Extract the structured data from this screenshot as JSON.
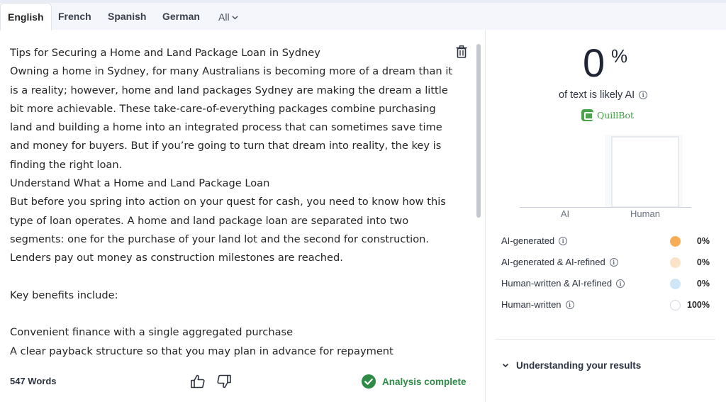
{
  "tabs": {
    "items": [
      {
        "label": "English",
        "active": true
      },
      {
        "label": "French",
        "active": false
      },
      {
        "label": "Spanish",
        "active": false
      },
      {
        "label": "German",
        "active": false
      }
    ],
    "all_label": "All"
  },
  "editor": {
    "paragraphs": [
      "Tips for Securing a Home and Land Package Loan in Sydney",
      "Owning a home in Sydney, for many Australians is becoming more of a dream than it is a reality; however, home and land packages Sydney are making the dream a little bit more achievable. These take-care-of-everything packages combine purchasing land and building a home into an integrated process that can sometimes save time and money for buyers. But if you’re going to turn that dream into reality, the key is finding the right loan.",
      "Understand What a Home and Land Package Loan",
      "But before you spring into action on your quest for cash, you need to know how this type of loan operates. A home and land package loan are separated into two segments: one for the purchase of your land lot and the second for construction. Lenders pay out money as construction milestones are reached.",
      "",
      "Key benefits include:",
      "",
      "Convenient finance with a single aggregated purchase",
      "A clear payback structure so that you may plan in advance for repayment"
    ],
    "word_count": "547 Words",
    "status": "Analysis complete"
  },
  "results": {
    "score": "0",
    "score_unit": "%",
    "caption": "of text is likely AI",
    "brand": "QuillBot",
    "legend": [
      {
        "label": "AI-generated",
        "color": "#f6ad55",
        "value": "0%"
      },
      {
        "label": "AI-generated & AI-refined",
        "color": "#fbe3c8",
        "value": "0%"
      },
      {
        "label": "Human-written & AI-refined",
        "color": "#cfe5f8",
        "value": "0%"
      },
      {
        "label": "Human-written",
        "color": "#ffffff",
        "value": "100%"
      }
    ],
    "understanding_label": "Understanding your results"
  },
  "chart_data": {
    "type": "bar",
    "categories": [
      "AI",
      "Human"
    ],
    "values": [
      0,
      100
    ],
    "ylim": [
      0,
      100
    ]
  },
  "colors": {
    "accent_green": "#2e8b45",
    "quillbot_green": "#4ba44c"
  }
}
